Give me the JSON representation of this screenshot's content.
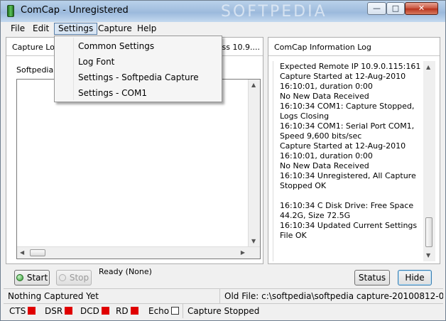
{
  "window": {
    "title": "ComCap - Unregistered",
    "watermark": "SOFTPEDIA",
    "minimize_label": "—",
    "maximize_label": "□",
    "close_label": "✕"
  },
  "menubar": {
    "items": [
      "File",
      "Edit",
      "Settings",
      "Capture",
      "Help"
    ],
    "active": "Settings"
  },
  "settings_menu": {
    "items": [
      "Common Settings",
      "Log Font",
      "Settings - Softpedia Capture",
      "Settings - COM1"
    ]
  },
  "left_pane": {
    "header": "Capture Log",
    "header_right": "ress 10.9....",
    "group_label": "Softpedia C"
  },
  "right_pane": {
    "header": "ComCap Information Log",
    "log": "Expected Remote IP 10.9.0.115:161\nCapture Started at 12-Aug-2010 16:10:01, duration 0:00\nNo New Data Received\n16:10:34 COM1: Capture Stopped, Logs Closing\n16:10:34 COM1: Serial Port COM1, Speed 9,600 bits/sec\nCapture Started at 12-Aug-2010 16:10:01, duration 0:00\nNo New Data Received\n16:10:34 Unregistered, All Capture Stopped OK\n\n16:10:34 C Disk Drive: Free Space 44.2G, Size 72.5G\n16:10:34 Updated Current Settings File OK"
  },
  "controls": {
    "start_label": "Start",
    "stop_label": "Stop",
    "ready_text": "Ready (None)",
    "status_label": "Status",
    "hide_label": "Hide"
  },
  "statusbar": {
    "left": "Nothing Captured Yet",
    "right": "Old File: c:\\softpedia\\softpedia capture-20100812-000000.t",
    "signals": [
      {
        "name": "CTS",
        "color": "#e00000"
      },
      {
        "name": "DSR",
        "color": "#e00000"
      },
      {
        "name": "DCD",
        "color": "#e00000"
      },
      {
        "name": "RD",
        "color": "#e00000"
      },
      {
        "name": "Echo",
        "color": "#ffffff"
      }
    ],
    "capture_status": "Capture Stopped"
  }
}
